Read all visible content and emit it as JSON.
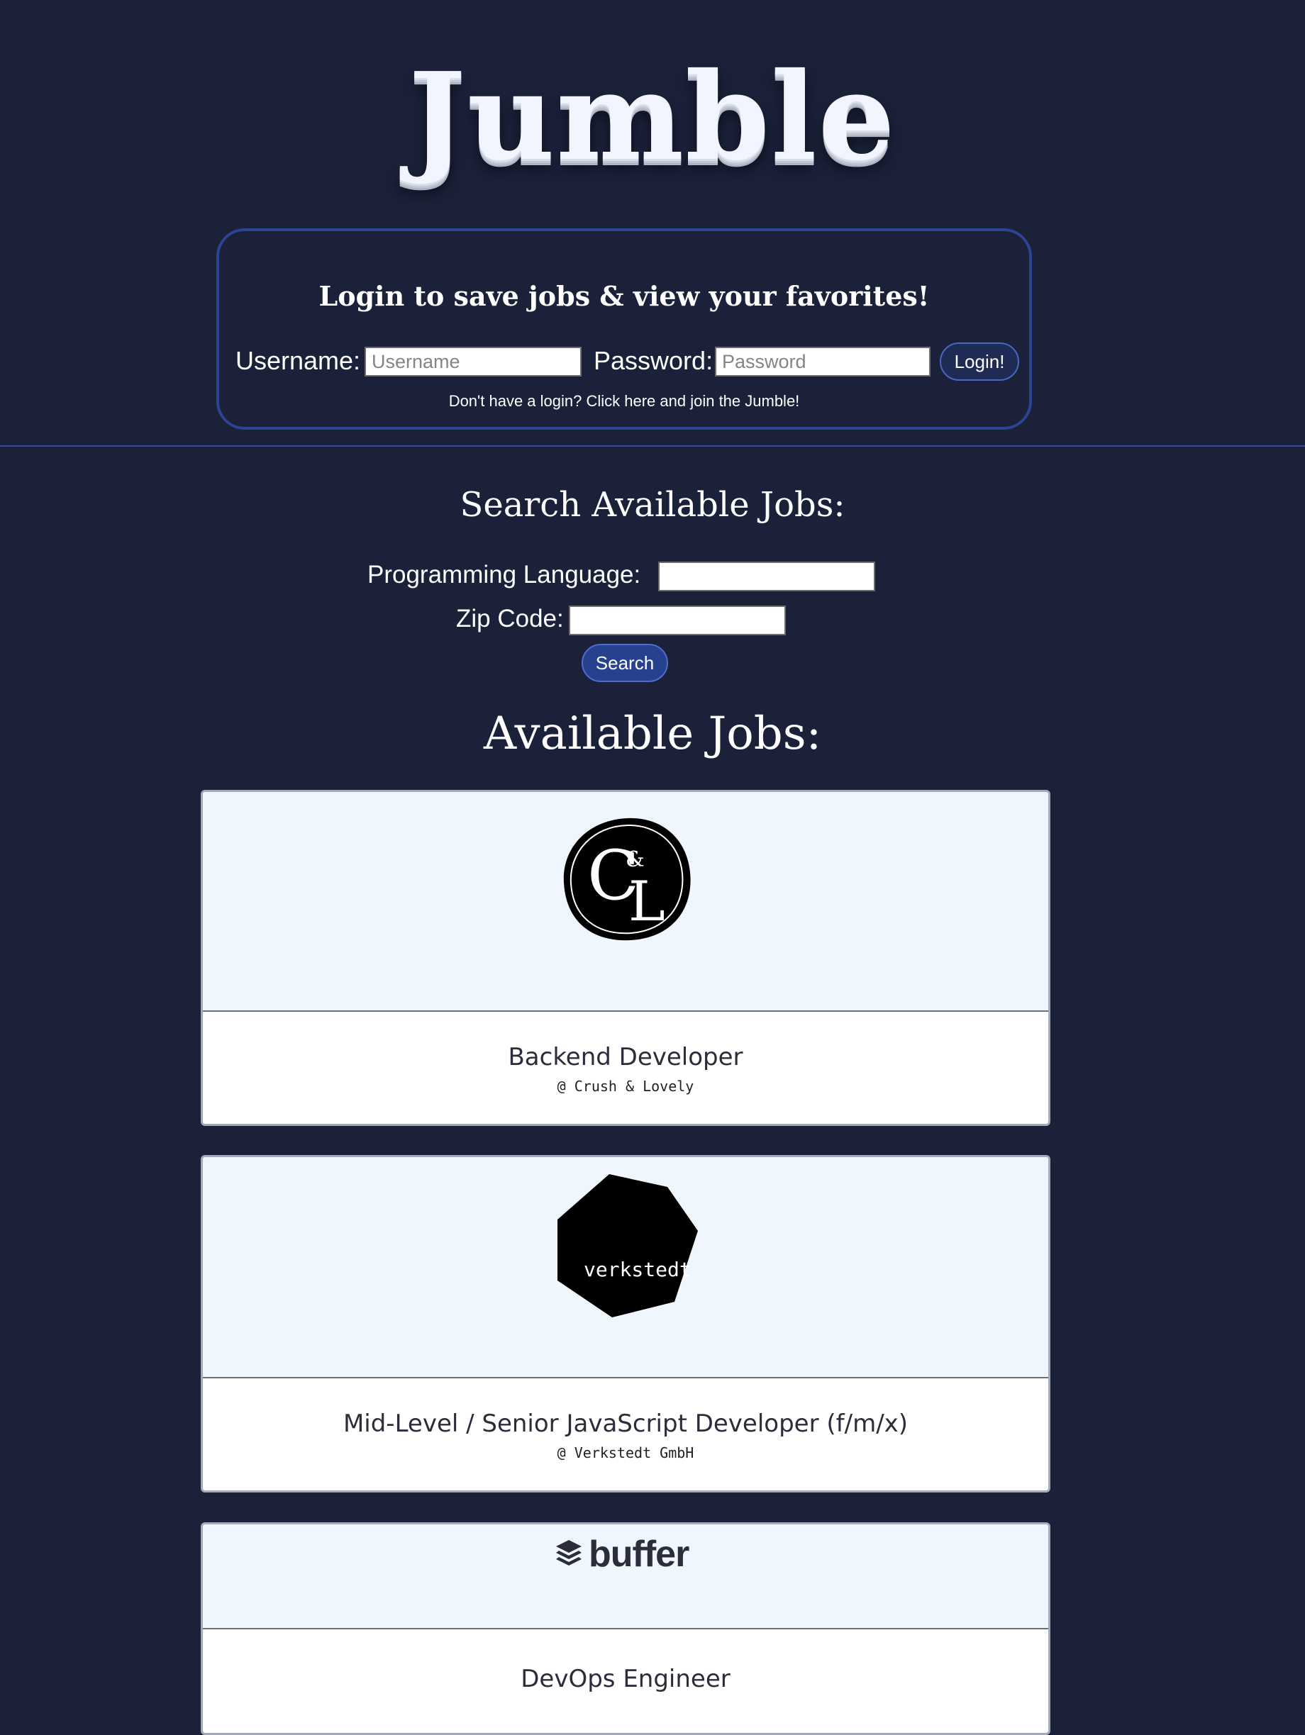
{
  "header": {
    "title": "Jumble"
  },
  "login": {
    "heading": "Login to save jobs & view your favorites!",
    "username_label": "Username:",
    "username_placeholder": "Username",
    "password_label": "Password:",
    "password_placeholder": "Password",
    "submit_label": "Login!",
    "signup_text": "Don't have a login? Click here and join the Jumble!"
  },
  "search": {
    "heading": "Search Available Jobs:",
    "language_label": "Programming Language:",
    "language_value": "",
    "zip_label": "Zip Code:",
    "zip_value": "",
    "button_label": "Search"
  },
  "jobs": {
    "heading": "Available Jobs:",
    "items": [
      {
        "title": "Backend Developer",
        "company": "@ Crush & Lovely",
        "logo": {
          "icon": "crush-and-lovely-logo",
          "text_top": "C",
          "text_amp": "&",
          "text_bottom": "L"
        }
      },
      {
        "title": "Mid-Level / Senior JavaScript Developer (f/m/x)",
        "company": "@ Verkstedt GmbH",
        "logo": {
          "icon": "verkstedt-logo",
          "text": "verkstedt"
        }
      },
      {
        "title": "DevOps Engineer",
        "company": "",
        "logo": {
          "icon": "buffer-logo",
          "text": "buffer"
        }
      }
    ]
  },
  "colors": {
    "background": "#1a2139",
    "accent": "#2b4494",
    "card_logo_bg": "#f0f6fd"
  }
}
